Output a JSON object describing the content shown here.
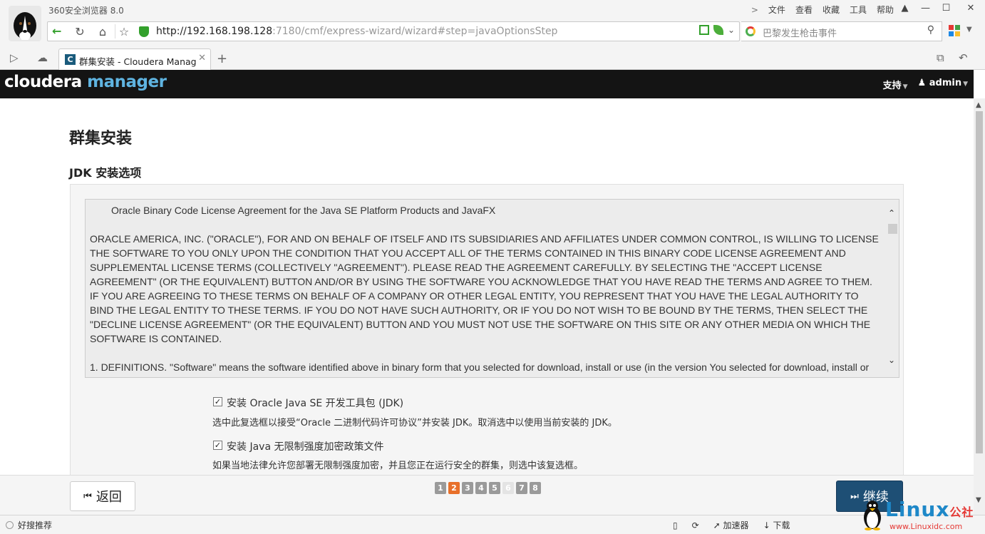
{
  "browser": {
    "app_title": "360安全浏览器 8.0",
    "menu": [
      "文件",
      "查看",
      "收藏",
      "工具",
      "帮助"
    ],
    "url_host": "http://192.168.198.128",
    "url_rest": ":7180/cmf/express-wizard/wizard#step=javaOptionsStep",
    "search_placeholder": "巴黎发生枪击事件",
    "tab_title": "群集安装 - Cloudera Manage",
    "status_left": "好搜推荐",
    "status_right": [
      "加速器",
      "下载"
    ]
  },
  "app": {
    "logo_main": "cloudera",
    "logo_sub": "manager",
    "support": "支持",
    "user": "admin"
  },
  "page": {
    "title": "群集安装",
    "section": "JDK 安装选项",
    "license": [
      "Oracle Binary Code License Agreement for the Java SE Platform Products and JavaFX",
      "ORACLE AMERICA, INC. (\"ORACLE\"), FOR AND ON BEHALF OF ITSELF AND ITS SUBSIDIARIES AND AFFILIATES UNDER COMMON CONTROL, IS WILLING TO LICENSE THE SOFTWARE TO YOU ONLY UPON THE CONDITION THAT YOU ACCEPT ALL OF THE TERMS CONTAINED IN THIS BINARY CODE LICENSE AGREEMENT AND SUPPLEMENTAL LICENSE TERMS (COLLECTIVELY \"AGREEMENT\"). PLEASE READ THE AGREEMENT CAREFULLY. BY SELECTING THE \"ACCEPT LICENSE AGREEMENT\" (OR THE EQUIVALENT) BUTTON AND/OR BY USING THE SOFTWARE YOU ACKNOWLEDGE THAT YOU HAVE READ THE TERMS AND AGREE TO THEM. IF YOU ARE AGREEING TO THESE TERMS ON BEHALF OF A COMPANY OR OTHER LEGAL ENTITY, YOU REPRESENT THAT YOU HAVE THE LEGAL AUTHORITY TO BIND THE LEGAL ENTITY TO THESE TERMS. IF YOU DO NOT HAVE SUCH AUTHORITY, OR IF YOU DO NOT WISH TO BE BOUND BY THE TERMS, THEN SELECT THE \"DECLINE LICENSE AGREEMENT\" (OR THE EQUIVALENT) BUTTON AND YOU MUST NOT USE THE SOFTWARE ON THIS SITE OR ANY OTHER MEDIA ON WHICH THE SOFTWARE IS CONTAINED.",
      "1. DEFINITIONS. \"Software\" means the software identified above in binary form that you selected for download, install or use (in the version You selected for download, install or"
    ],
    "option1_label": "安装 Oracle Java SE 开发工具包 (JDK)",
    "option1_help": "选中此复选框以接受“Oracle 二进制代码许可协议”并安装 JDK。取消选中以使用当前安装的 JDK。",
    "option1_checked": true,
    "option2_label": "安装 Java 无限制强度加密政策文件",
    "option2_help": "如果当地法律允许您部署无限制强度加密，并且您正在运行安全的群集，则选中该复选框。",
    "option2_checked": true
  },
  "footer": {
    "back": "返回",
    "next": "继续",
    "steps": [
      "1",
      "2",
      "3",
      "4",
      "5",
      "6",
      "7",
      "8"
    ],
    "active_step": "2",
    "disabled_step": "6"
  },
  "watermark": {
    "brand": "Linux",
    "brand_cn": "公社",
    "url": "www.Linuxidc.com"
  },
  "colors": {
    "accent": "#1e4f75",
    "active_step": "#e8702a",
    "logo_sub": "#5fb4e1"
  }
}
